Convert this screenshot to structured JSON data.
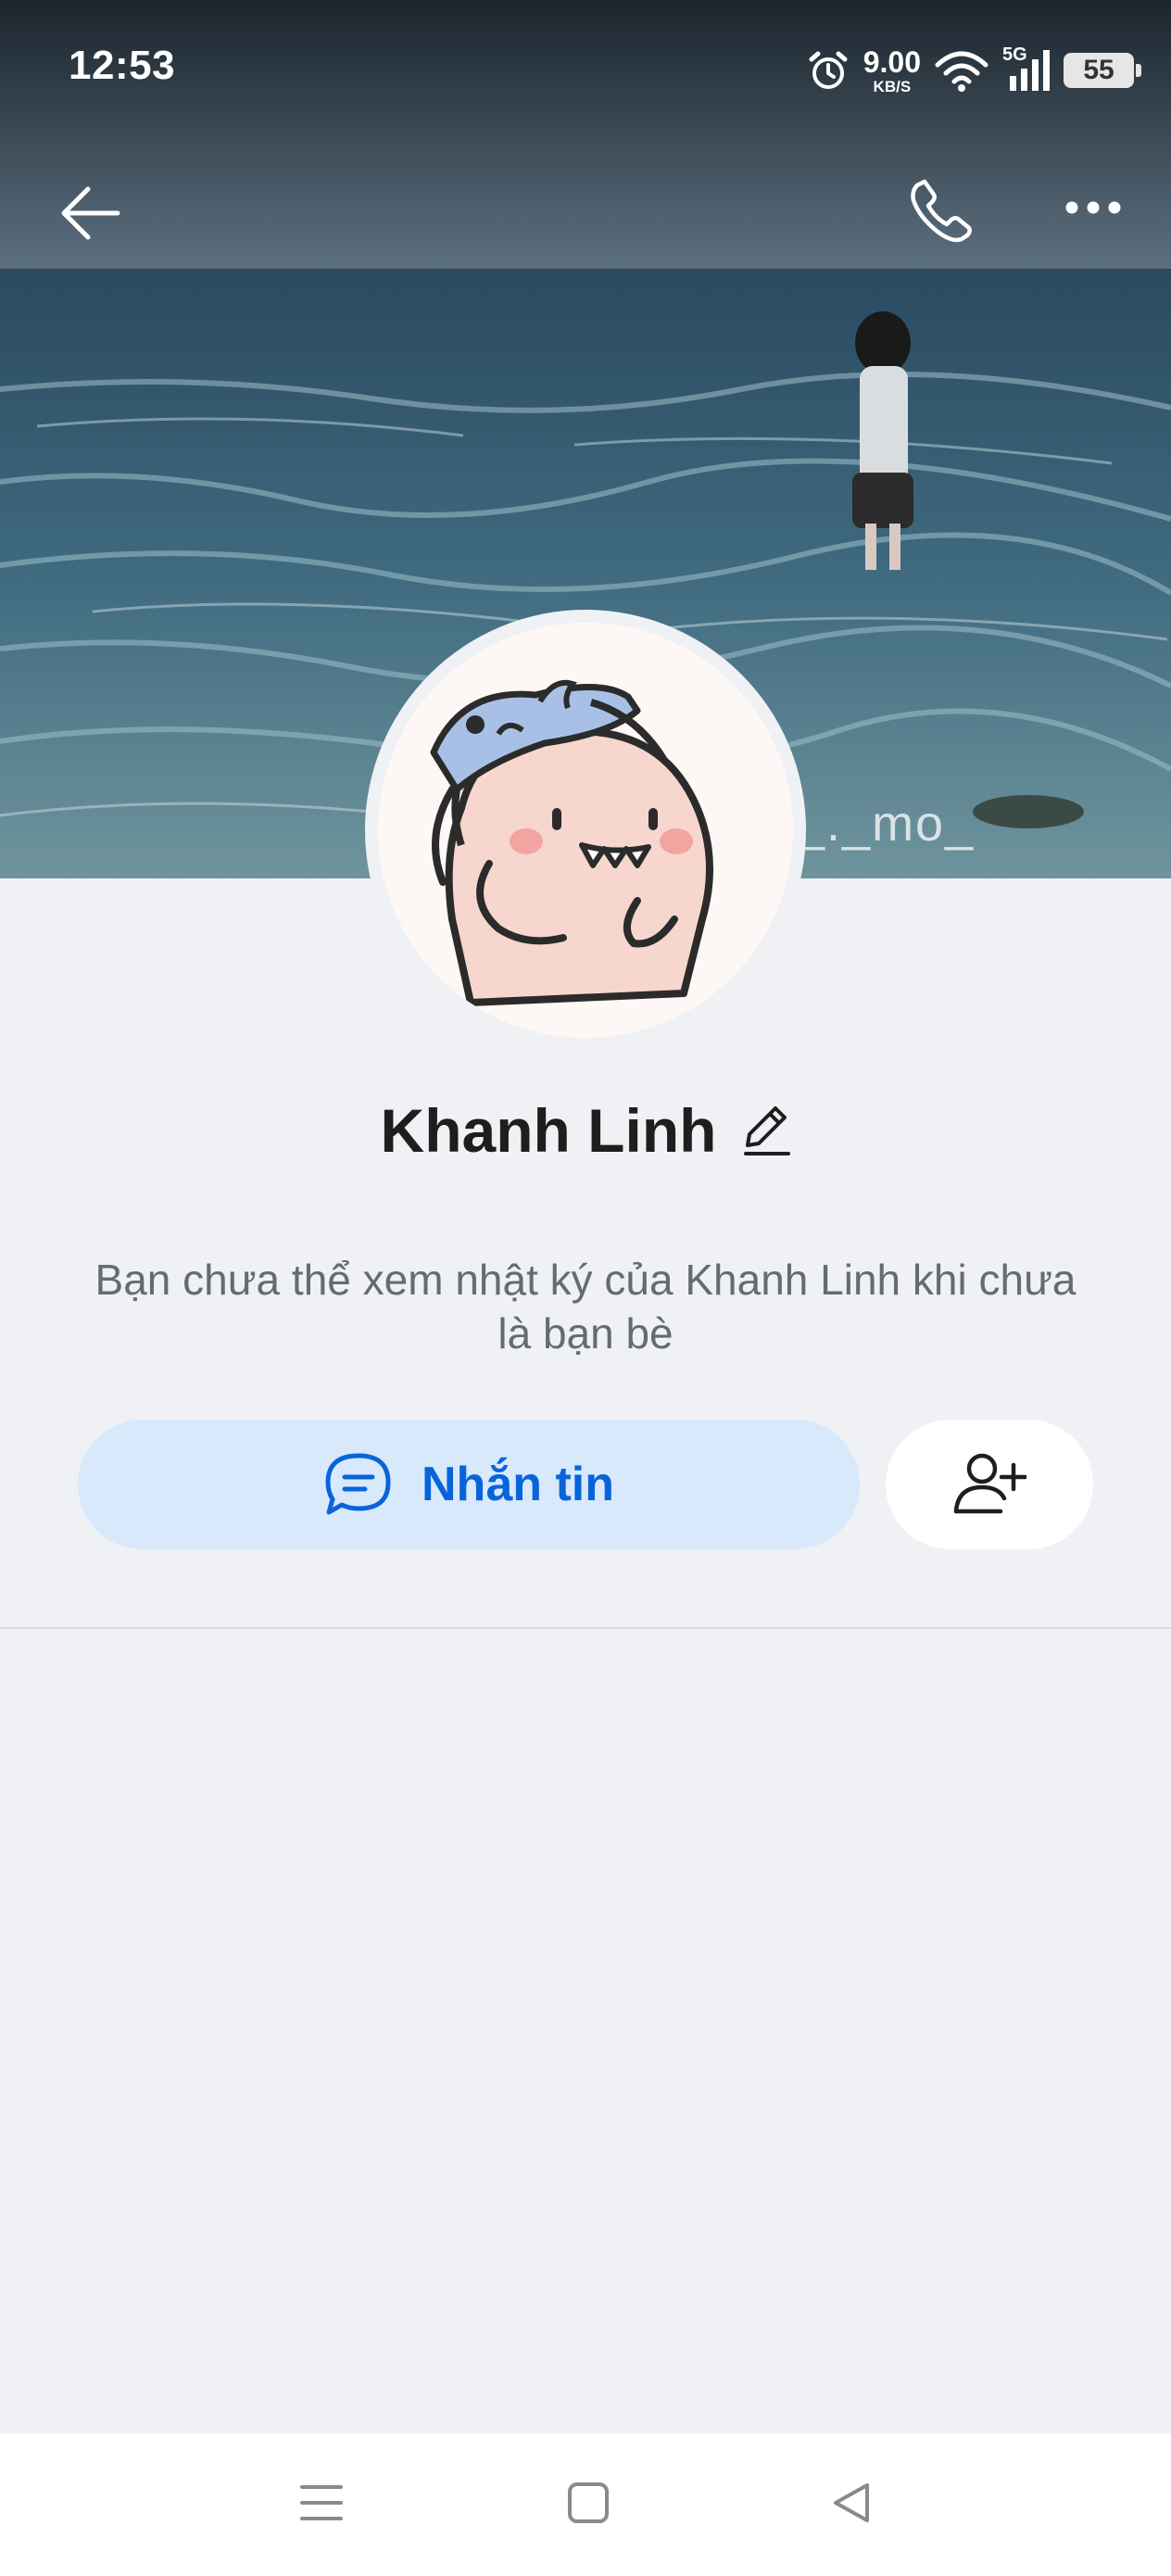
{
  "status_bar": {
    "time": "12:53",
    "net_speed_value": "9.00",
    "net_speed_unit": "KB/S",
    "network_type": "5G",
    "battery": "55"
  },
  "header": {
    "cover_watermark": "_._mo_"
  },
  "profile": {
    "name": "Khanh Linh",
    "notice": "Bạn chưa thể xem nhật ký của Khanh Linh khi chưa là bạn bè"
  },
  "actions": {
    "message_label": "Nhắn tin"
  },
  "colors": {
    "accent": "#0a64d9",
    "message_button_bg": "#d8e9fc",
    "page_bg": "#eff1f5"
  },
  "icons": {
    "back": "arrow-left-icon",
    "call": "phone-icon",
    "more": "more-horizontal-icon",
    "edit": "pencil-icon",
    "message": "chat-bubble-icon",
    "add_friend": "add-user-icon",
    "nav_menu": "menu-icon",
    "nav_home": "home-square-icon",
    "nav_back": "back-triangle-icon"
  }
}
